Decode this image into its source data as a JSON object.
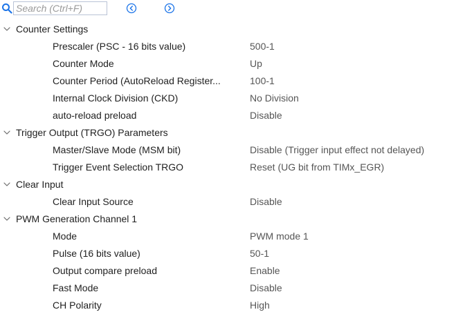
{
  "search": {
    "placeholder": "Search (Ctrl+F)"
  },
  "icons": {
    "search": "magnifier-icon",
    "prev": "circle-chevron-left-icon",
    "next": "circle-chevron-right-icon",
    "expand": "chevron-down-icon"
  },
  "colors": {
    "accent": "#1a73e8",
    "value_text": "#555555",
    "label_text": "#1f1f1f"
  },
  "groups": [
    {
      "label": "Counter Settings",
      "params": [
        {
          "name": "Prescaler (PSC - 16 bits value)",
          "value": "500-1"
        },
        {
          "name": "Counter Mode",
          "value": "Up"
        },
        {
          "name": "Counter Period (AutoReload Register...",
          "value": "100-1"
        },
        {
          "name": "Internal Clock Division (CKD)",
          "value": "No Division"
        },
        {
          "name": "auto-reload preload",
          "value": "Disable"
        }
      ]
    },
    {
      "label": "Trigger Output (TRGO) Parameters",
      "params": [
        {
          "name": "Master/Slave Mode (MSM bit)",
          "value": "Disable (Trigger input effect not delayed)"
        },
        {
          "name": "Trigger Event Selection TRGO",
          "value": "Reset (UG bit from TIMx_EGR)"
        }
      ]
    },
    {
      "label": "Clear Input",
      "params": [
        {
          "name": "Clear Input Source",
          "value": "Disable"
        }
      ]
    },
    {
      "label": "PWM Generation Channel 1",
      "params": [
        {
          "name": "Mode",
          "value": "PWM mode 1"
        },
        {
          "name": "Pulse (16 bits value)",
          "value": "50-1"
        },
        {
          "name": "Output compare preload",
          "value": "Enable"
        },
        {
          "name": "Fast Mode",
          "value": "Disable"
        },
        {
          "name": "CH Polarity",
          "value": "High"
        }
      ]
    }
  ]
}
